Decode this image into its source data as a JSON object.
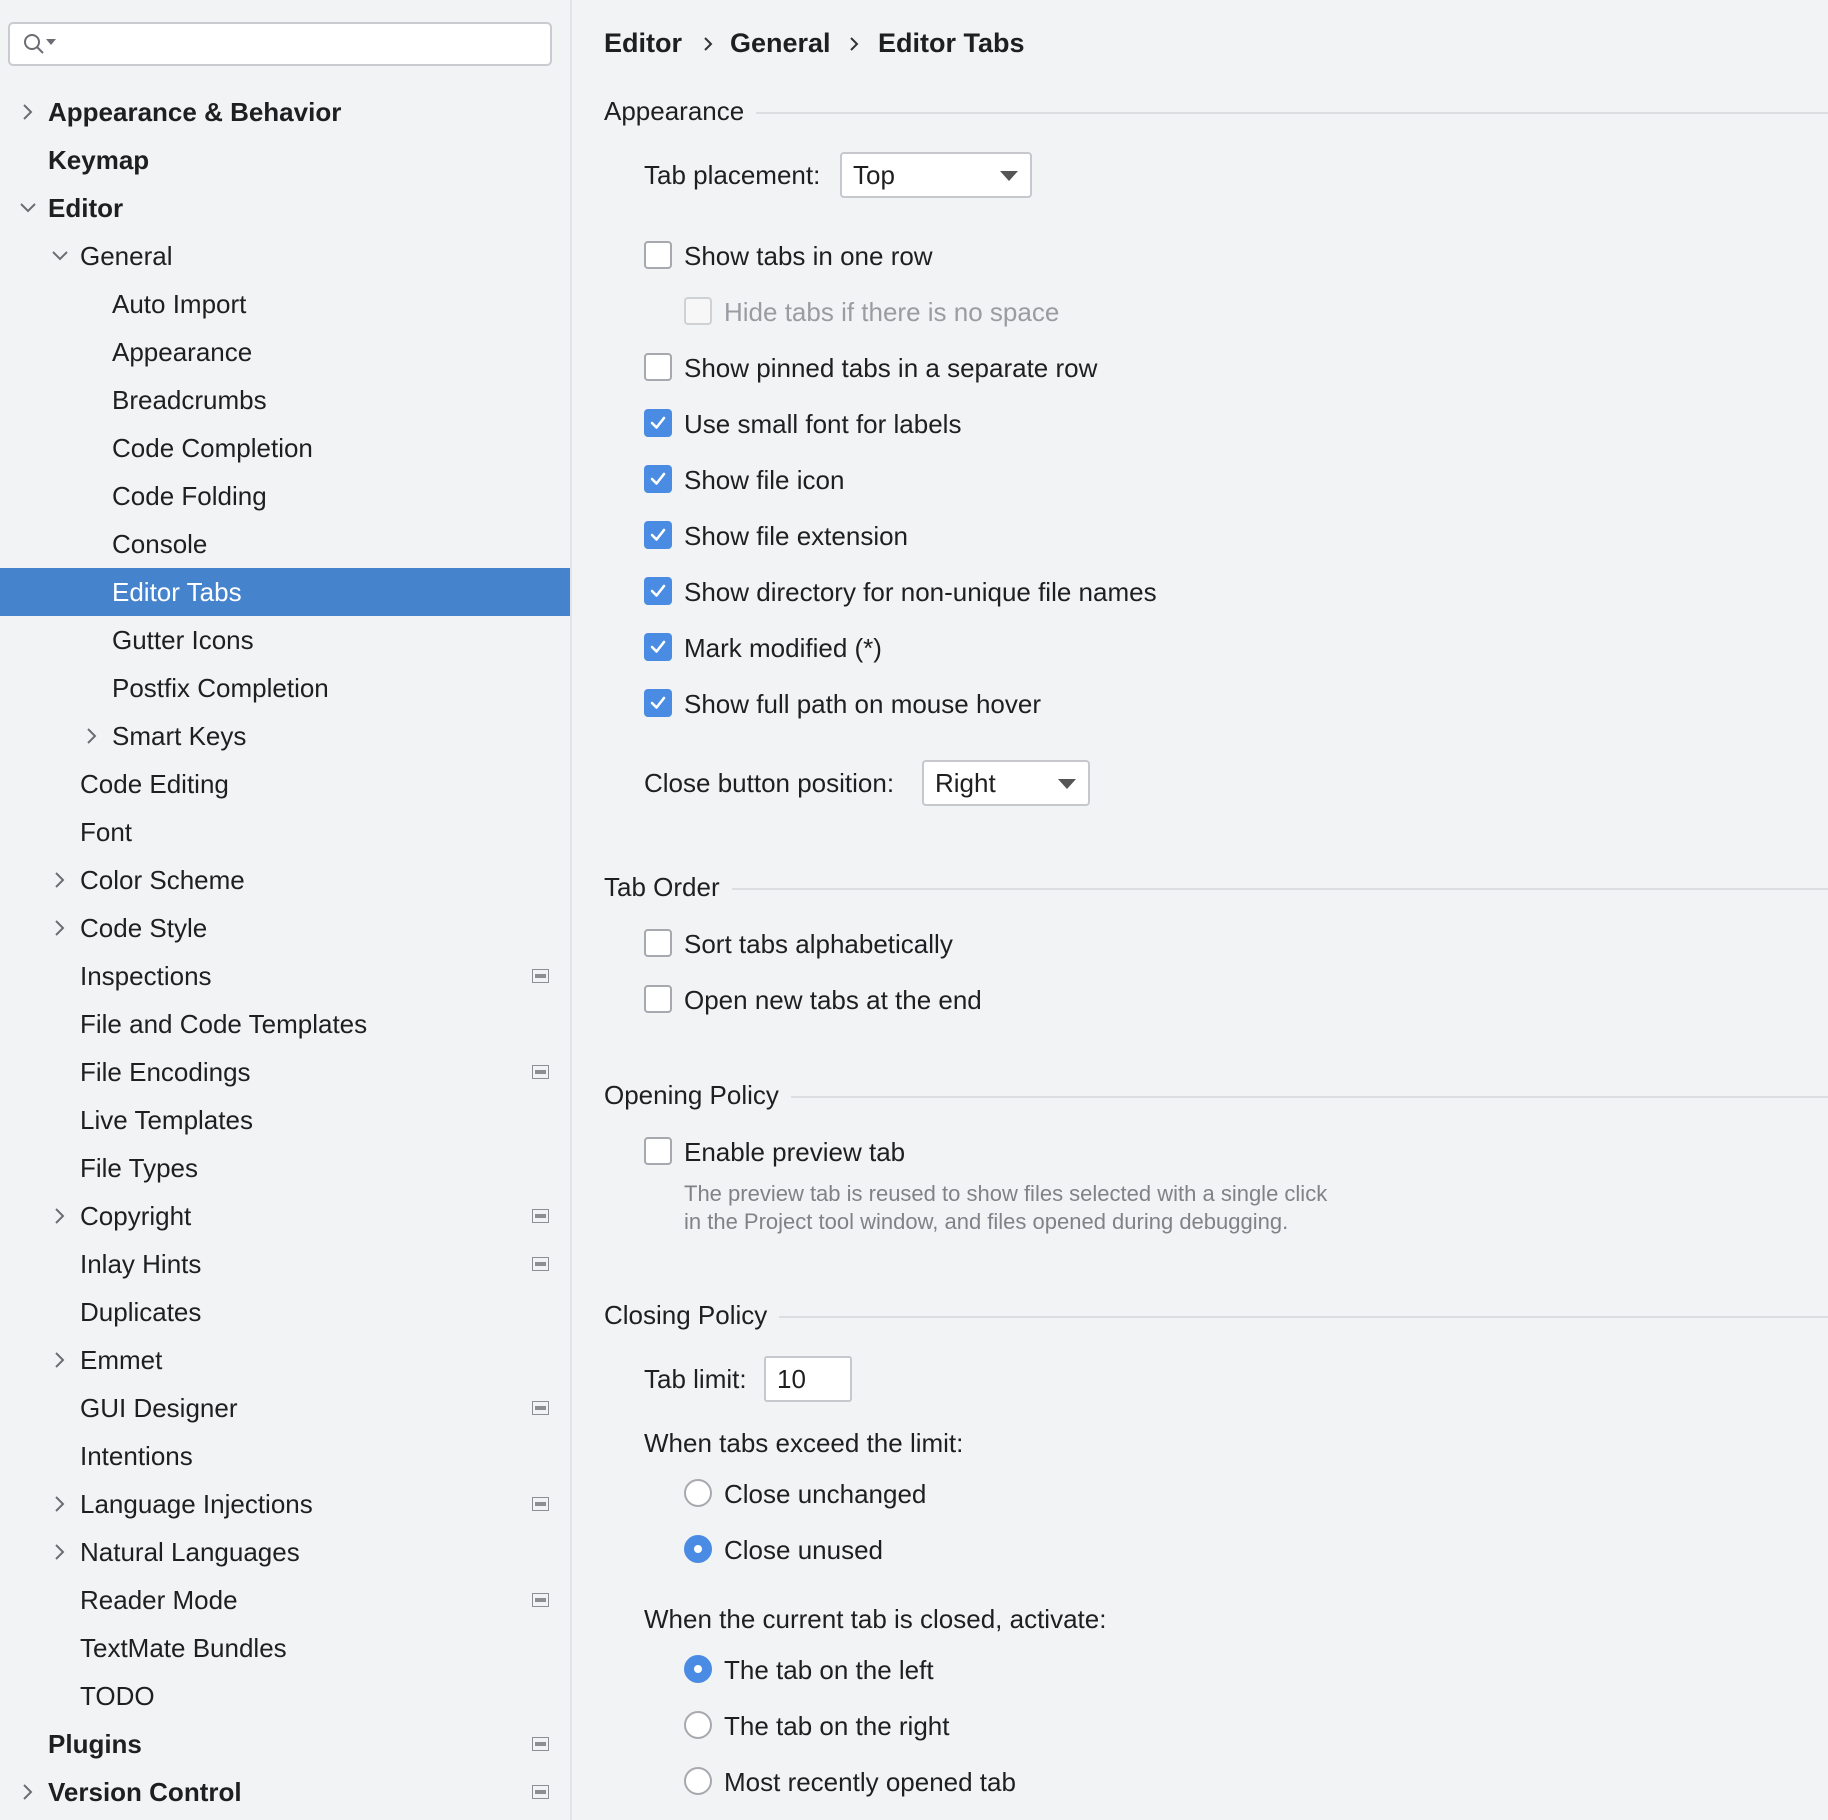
{
  "search": {
    "placeholder": "",
    "value": ""
  },
  "sidebar": {
    "items": [
      {
        "label": "Appearance & Behavior",
        "level": 0,
        "bold": true,
        "expander": "collapsed",
        "proj": false
      },
      {
        "label": "Keymap",
        "level": 0,
        "bold": true,
        "expander": "none",
        "proj": false
      },
      {
        "label": "Editor",
        "level": 0,
        "bold": true,
        "expander": "expanded",
        "proj": false
      },
      {
        "label": "General",
        "level": 1,
        "bold": false,
        "expander": "expanded",
        "proj": false
      },
      {
        "label": "Auto Import",
        "level": 2,
        "bold": false,
        "expander": "none",
        "proj": false
      },
      {
        "label": "Appearance",
        "level": 2,
        "bold": false,
        "expander": "none",
        "proj": false
      },
      {
        "label": "Breadcrumbs",
        "level": 2,
        "bold": false,
        "expander": "none",
        "proj": false
      },
      {
        "label": "Code Completion",
        "level": 2,
        "bold": false,
        "expander": "none",
        "proj": false
      },
      {
        "label": "Code Folding",
        "level": 2,
        "bold": false,
        "expander": "none",
        "proj": false
      },
      {
        "label": "Console",
        "level": 2,
        "bold": false,
        "expander": "none",
        "proj": false
      },
      {
        "label": "Editor Tabs",
        "level": 2,
        "bold": false,
        "expander": "none",
        "proj": false,
        "selected": true
      },
      {
        "label": "Gutter Icons",
        "level": 2,
        "bold": false,
        "expander": "none",
        "proj": false
      },
      {
        "label": "Postfix Completion",
        "level": 2,
        "bold": false,
        "expander": "none",
        "proj": false
      },
      {
        "label": "Smart Keys",
        "level": 2,
        "bold": false,
        "expander": "collapsed",
        "proj": false
      },
      {
        "label": "Code Editing",
        "level": 1,
        "bold": false,
        "expander": "none",
        "proj": false
      },
      {
        "label": "Font",
        "level": 1,
        "bold": false,
        "expander": "none",
        "proj": false
      },
      {
        "label": "Color Scheme",
        "level": 1,
        "bold": false,
        "expander": "collapsed",
        "proj": false
      },
      {
        "label": "Code Style",
        "level": 1,
        "bold": false,
        "expander": "collapsed",
        "proj": false
      },
      {
        "label": "Inspections",
        "level": 1,
        "bold": false,
        "expander": "none",
        "proj": true
      },
      {
        "label": "File and Code Templates",
        "level": 1,
        "bold": false,
        "expander": "none",
        "proj": false
      },
      {
        "label": "File Encodings",
        "level": 1,
        "bold": false,
        "expander": "none",
        "proj": true
      },
      {
        "label": "Live Templates",
        "level": 1,
        "bold": false,
        "expander": "none",
        "proj": false
      },
      {
        "label": "File Types",
        "level": 1,
        "bold": false,
        "expander": "none",
        "proj": false
      },
      {
        "label": "Copyright",
        "level": 1,
        "bold": false,
        "expander": "collapsed",
        "proj": true
      },
      {
        "label": "Inlay Hints",
        "level": 1,
        "bold": false,
        "expander": "none",
        "proj": true
      },
      {
        "label": "Duplicates",
        "level": 1,
        "bold": false,
        "expander": "none",
        "proj": false
      },
      {
        "label": "Emmet",
        "level": 1,
        "bold": false,
        "expander": "collapsed",
        "proj": false
      },
      {
        "label": "GUI Designer",
        "level": 1,
        "bold": false,
        "expander": "none",
        "proj": true
      },
      {
        "label": "Intentions",
        "level": 1,
        "bold": false,
        "expander": "none",
        "proj": false
      },
      {
        "label": "Language Injections",
        "level": 1,
        "bold": false,
        "expander": "collapsed",
        "proj": true
      },
      {
        "label": "Natural Languages",
        "level": 1,
        "bold": false,
        "expander": "collapsed",
        "proj": false
      },
      {
        "label": "Reader Mode",
        "level": 1,
        "bold": false,
        "expander": "none",
        "proj": true
      },
      {
        "label": "TextMate Bundles",
        "level": 1,
        "bold": false,
        "expander": "none",
        "proj": false
      },
      {
        "label": "TODO",
        "level": 1,
        "bold": false,
        "expander": "none",
        "proj": false
      },
      {
        "label": "Plugins",
        "level": 0,
        "bold": true,
        "expander": "none",
        "proj": true
      },
      {
        "label": "Version Control",
        "level": 0,
        "bold": true,
        "expander": "collapsed",
        "proj": true
      }
    ]
  },
  "breadcrumb": [
    "Editor",
    "General",
    "Editor Tabs"
  ],
  "appearance": {
    "title": "Appearance",
    "tab_placement_label": "Tab placement:",
    "tab_placement_value": "Top",
    "checkboxes": [
      {
        "label": "Show tabs in one row",
        "checked": false,
        "disabled": false,
        "indent": false
      },
      {
        "label": "Hide tabs if there is no space",
        "checked": false,
        "disabled": true,
        "indent": true
      },
      {
        "label": "Show pinned tabs in a separate row",
        "checked": false,
        "disabled": false,
        "indent": false
      },
      {
        "label": "Use small font for labels",
        "checked": true,
        "disabled": false,
        "indent": false
      },
      {
        "label": "Show file icon",
        "checked": true,
        "disabled": false,
        "indent": false
      },
      {
        "label": "Show file extension",
        "checked": true,
        "disabled": false,
        "indent": false
      },
      {
        "label": "Show directory for non-unique file names",
        "checked": true,
        "disabled": false,
        "indent": false
      },
      {
        "label": "Mark modified (*)",
        "checked": true,
        "disabled": false,
        "indent": false
      },
      {
        "label": "Show full path on mouse hover",
        "checked": true,
        "disabled": false,
        "indent": false
      }
    ],
    "close_button_label": "Close button position:",
    "close_button_value": "Right"
  },
  "tab_order": {
    "title": "Tab Order",
    "checkboxes": [
      {
        "label": "Sort tabs alphabetically",
        "checked": false
      },
      {
        "label": "Open new tabs at the end",
        "checked": false
      }
    ]
  },
  "opening_policy": {
    "title": "Opening Policy",
    "preview_label": "Enable preview tab",
    "preview_checked": false,
    "hint_line1": "The preview tab is reused to show files selected with a single click",
    "hint_line2": "in the Project tool window, and files opened during debugging."
  },
  "closing_policy": {
    "title": "Closing Policy",
    "tab_limit_label": "Tab limit:",
    "tab_limit_value": "10",
    "exceed_label": "When tabs exceed the limit:",
    "exceed_options": [
      {
        "label": "Close unchanged",
        "selected": false
      },
      {
        "label": "Close unused",
        "selected": true
      }
    ],
    "activate_label": "When the current tab is closed, activate:",
    "activate_options": [
      {
        "label": "The tab on the left",
        "selected": true
      },
      {
        "label": "The tab on the right",
        "selected": false
      },
      {
        "label": "Most recently opened tab",
        "selected": false
      }
    ]
  },
  "colors": {
    "accent": "#4a8be4",
    "selection": "#4583cd",
    "background": "#f2f3f5"
  }
}
